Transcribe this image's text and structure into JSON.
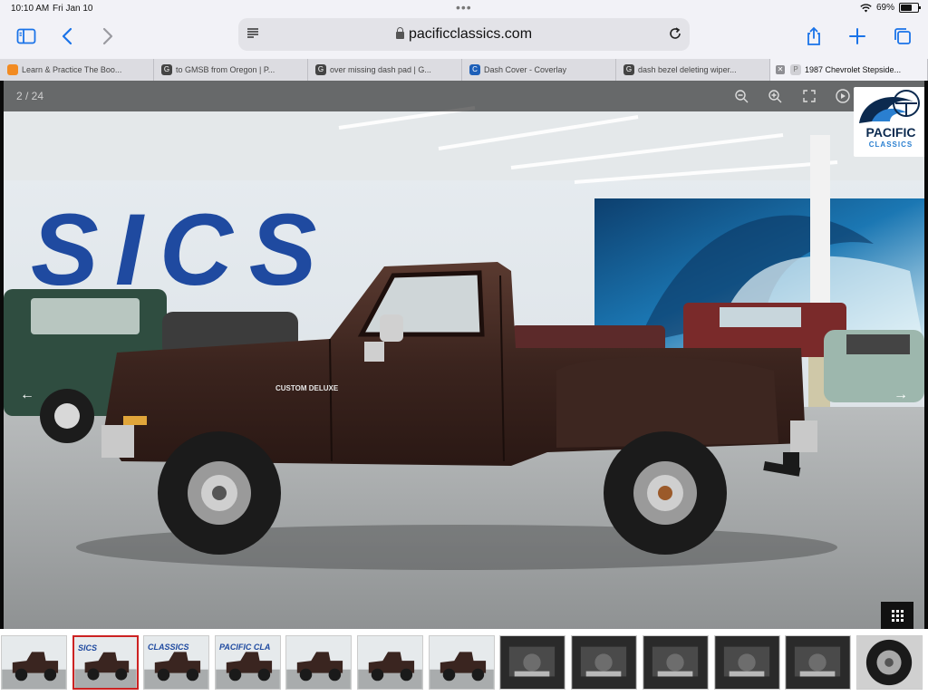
{
  "status": {
    "time": "10:10 AM",
    "date": "Fri Jan 10",
    "battery": "69%",
    "battery_level": 0.69
  },
  "address": {
    "domain": "pacificclassics.com"
  },
  "tabs": [
    {
      "label": "Learn & Practice The Boo...",
      "favicon": "orange-tag-icon"
    },
    {
      "label": "to GMSB from Oregon | P...",
      "favicon": "G"
    },
    {
      "label": "over missing dash pad | G...",
      "favicon": "G"
    },
    {
      "label": "Dash Cover - Coverlay",
      "favicon": "C"
    },
    {
      "label": "dash bezel deleting wiper...",
      "favicon": "G"
    },
    {
      "label": "1987 Chevrolet Stepside...",
      "favicon": "P",
      "active": true
    }
  ],
  "viewer": {
    "counter": "2 / 24",
    "logo_line1": "PACIFIC",
    "logo_line2": "CLASSICS",
    "wall_text": "SICS",
    "badge_text": "CUSTOM DELUXE"
  },
  "thumbnails": [
    {
      "label": "",
      "kind": "truck-front"
    },
    {
      "label": "SICS",
      "kind": "truck-side",
      "active": true
    },
    {
      "label": "CLASSICS",
      "kind": "truck-side"
    },
    {
      "label": "PACIFIC CLA",
      "kind": "truck-rear"
    },
    {
      "label": "",
      "kind": "truck-side"
    },
    {
      "label": "",
      "kind": "truck-side"
    },
    {
      "label": "",
      "kind": "truck-front"
    },
    {
      "label": "",
      "kind": "engine"
    },
    {
      "label": "",
      "kind": "engine"
    },
    {
      "label": "",
      "kind": "engine"
    },
    {
      "label": "",
      "kind": "engine"
    },
    {
      "label": "",
      "kind": "engine"
    },
    {
      "label": "",
      "kind": "wheel"
    }
  ]
}
